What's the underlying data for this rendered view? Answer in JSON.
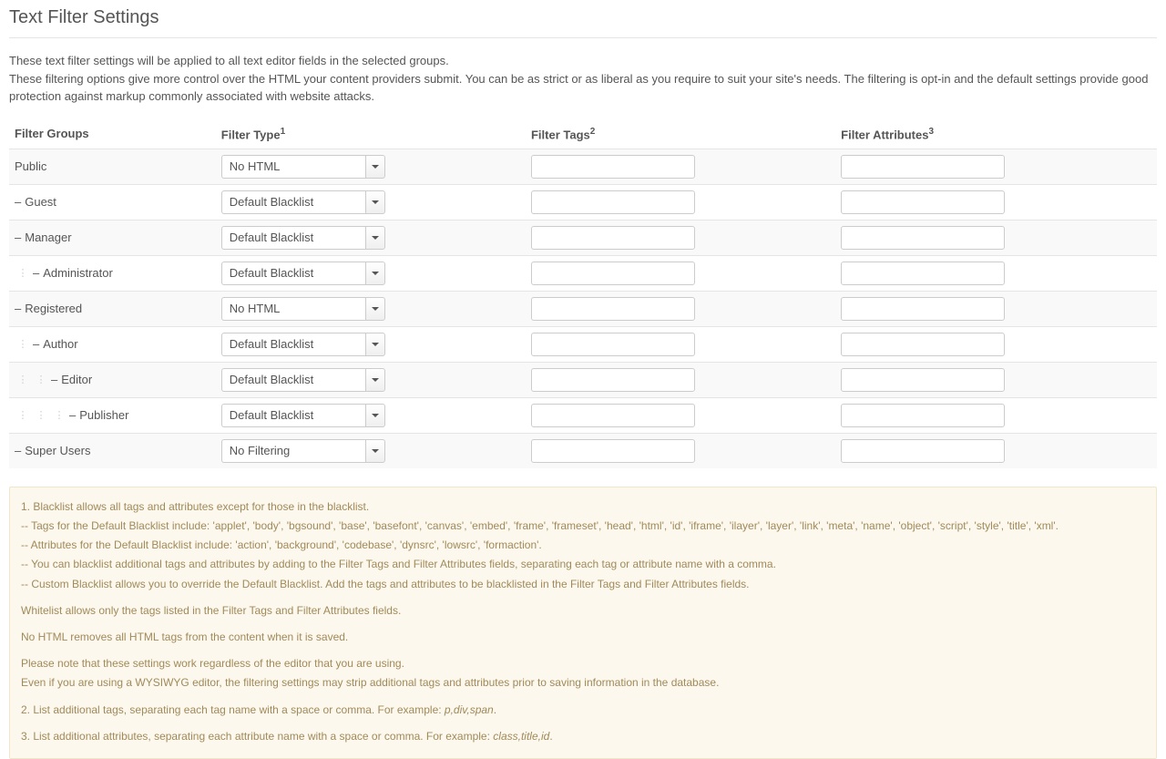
{
  "page": {
    "title": "Text Filter Settings"
  },
  "description": {
    "line1": "These text filter settings will be applied to all text editor fields in the selected groups.",
    "line2": "These filtering options give more control over the HTML your content providers submit. You can be as strict or as liberal as you require to suit your site's needs. The filtering is opt-in and the default settings provide good protection against markup commonly associated with website attacks."
  },
  "headers": {
    "groups": "Filter Groups",
    "type": "Filter Type",
    "type_sup": "1",
    "tags": "Filter Tags",
    "tags_sup": "2",
    "attrs": "Filter Attributes",
    "attrs_sup": "3"
  },
  "rows": [
    {
      "indent": 0,
      "dash": false,
      "name": "Public",
      "type": "No HTML",
      "tags": "",
      "attrs": ""
    },
    {
      "indent": 0,
      "dash": true,
      "name": "Guest",
      "type": "Default Blacklist",
      "tags": "",
      "attrs": ""
    },
    {
      "indent": 0,
      "dash": true,
      "name": "Manager",
      "type": "Default Blacklist",
      "tags": "",
      "attrs": ""
    },
    {
      "indent": 1,
      "dash": true,
      "name": "Administrator",
      "type": "Default Blacklist",
      "tags": "",
      "attrs": ""
    },
    {
      "indent": 0,
      "dash": true,
      "name": "Registered",
      "type": "No HTML",
      "tags": "",
      "attrs": ""
    },
    {
      "indent": 1,
      "dash": true,
      "name": "Author",
      "type": "Default Blacklist",
      "tags": "",
      "attrs": ""
    },
    {
      "indent": 2,
      "dash": true,
      "name": "Editor",
      "type": "Default Blacklist",
      "tags": "",
      "attrs": ""
    },
    {
      "indent": 3,
      "dash": true,
      "name": "Publisher",
      "type": "Default Blacklist",
      "tags": "",
      "attrs": ""
    },
    {
      "indent": 0,
      "dash": true,
      "name": "Super Users",
      "type": "No Filtering",
      "tags": "",
      "attrs": ""
    }
  ],
  "notes": {
    "n1_line1": "1. Blacklist allows all tags and attributes except for those in the blacklist.",
    "n1_line2": "-- Tags for the Default Blacklist include: 'applet', 'body', 'bgsound', 'base', 'basefont', 'canvas', 'embed', 'frame', 'frameset', 'head', 'html', 'id', 'iframe', 'ilayer', 'layer', 'link', 'meta', 'name', 'object', 'script', 'style', 'title', 'xml'.",
    "n1_line3": "-- Attributes for the Default Blacklist include: 'action', 'background', 'codebase', 'dynsrc', 'lowsrc', 'formaction'.",
    "n1_line4": "-- You can blacklist additional tags and attributes by adding to the Filter Tags and Filter Attributes fields, separating each tag or attribute name with a comma.",
    "n1_line5": "-- Custom Blacklist allows you to override the Default Blacklist. Add the tags and attributes to be blacklisted in the Filter Tags and Filter Attributes fields.",
    "whitelist": "Whitelist allows only the tags listed in the Filter Tags and Filter Attributes fields.",
    "nohtml": "No HTML removes all HTML tags from the content when it is saved.",
    "note_line1": "Please note that these settings work regardless of the editor that you are using.",
    "note_line2": "Even if you are using a WYSIWYG editor, the filtering settings may strip additional tags and attributes prior to saving information in the database.",
    "n2_text": "2. List additional tags, separating each tag name with a space or comma. For example: ",
    "n2_example": "p,div,span",
    "n2_period": ".",
    "n3_text": "3. List additional attributes, separating each attribute name with a space or comma. For example: ",
    "n3_example": "class,title,id",
    "n3_period": "."
  }
}
